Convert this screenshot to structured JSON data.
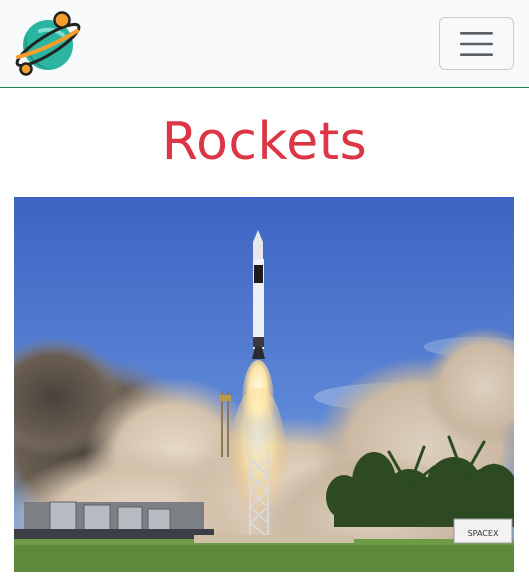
{
  "navbar": {
    "logo_icon": "planet-icon",
    "toggler_icon": "hamburger-icon",
    "border_color": "#198754"
  },
  "main": {
    "title": "Rockets",
    "title_color": "#dc3545",
    "hero_image": {
      "subject": "rocket-launch-photo",
      "sign_text": "SPACEX"
    }
  }
}
